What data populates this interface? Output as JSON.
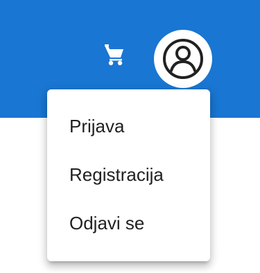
{
  "header": {
    "background_color": "#1976d2",
    "icons": {
      "cart": "shopping-cart-icon",
      "account": "account-circle-icon"
    }
  },
  "menu": {
    "items": [
      {
        "label": "Prijava"
      },
      {
        "label": "Registracija"
      },
      {
        "label": "Odjavi se"
      }
    ]
  }
}
